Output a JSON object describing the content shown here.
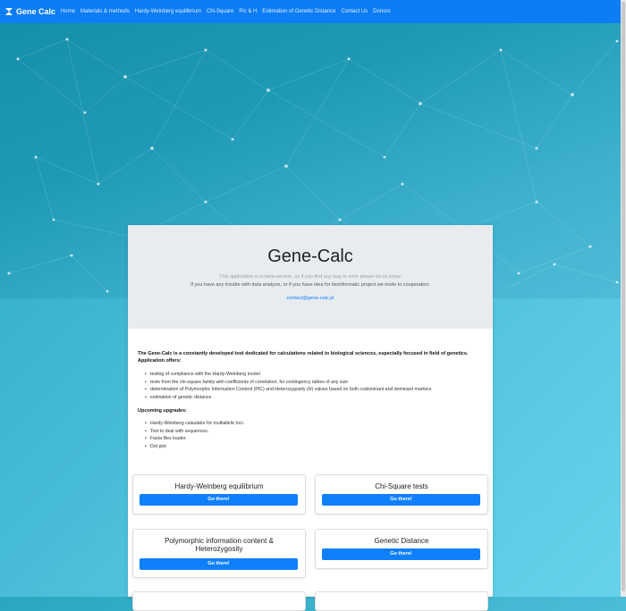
{
  "navbar": {
    "brand": "Gene Calc",
    "items": [
      "Home",
      "Materials & methods",
      "Hardy-Weinberg equilibrium",
      "Chi-Square",
      "Pic & H",
      "Estimation of Genetic Distance",
      "Contact Us",
      "Donors"
    ]
  },
  "jumbotron": {
    "title": "Gene-Calc",
    "beta_text": "This application is in beta-version, so if you find any bug or error please let us know.",
    "trouble_text": "If you have any trouble with data analysis, or if you have idea for bioinformatic project we invite to cooperation.",
    "contact_email": "contact@gene-calc.pl"
  },
  "intro": {
    "description": "The Gene-Calc is a constantly developed tool dedicated for calculations related to biological sciences, especially focused in field of genetics. Application offers:",
    "features": [
      "testing of compliance with the Hardy-Weinberg model",
      "tests from the chi-square family with coefficients of correlation, for contingency tables of any size",
      "determination of Polymorphic Information Content (PIC) and Heterozygosity (H) values based on both codominant and dominant markers",
      "estimation of genetic distance"
    ],
    "upcoming_title": "Upcoming upgrades:",
    "upcoming": [
      "Hardy-Weinberg calaulator for multiallelic loci.",
      "Tool to deal with sequences.",
      "Fasta files loader.",
      "Dot plot"
    ]
  },
  "cards": [
    {
      "title": "Hardy-Weinberg equilibrium",
      "button": "Go there!"
    },
    {
      "title": "Chi-Square tests",
      "button": "Go there!"
    },
    {
      "title": "Polymorphic information content & Heterozygosity",
      "button": "Go there!"
    },
    {
      "title": "Genetic Distance",
      "button": "Go there!"
    }
  ],
  "colors": {
    "navbar": "#0d7df5",
    "button": "#1080fa",
    "jumbotron": "#e9ecef"
  }
}
